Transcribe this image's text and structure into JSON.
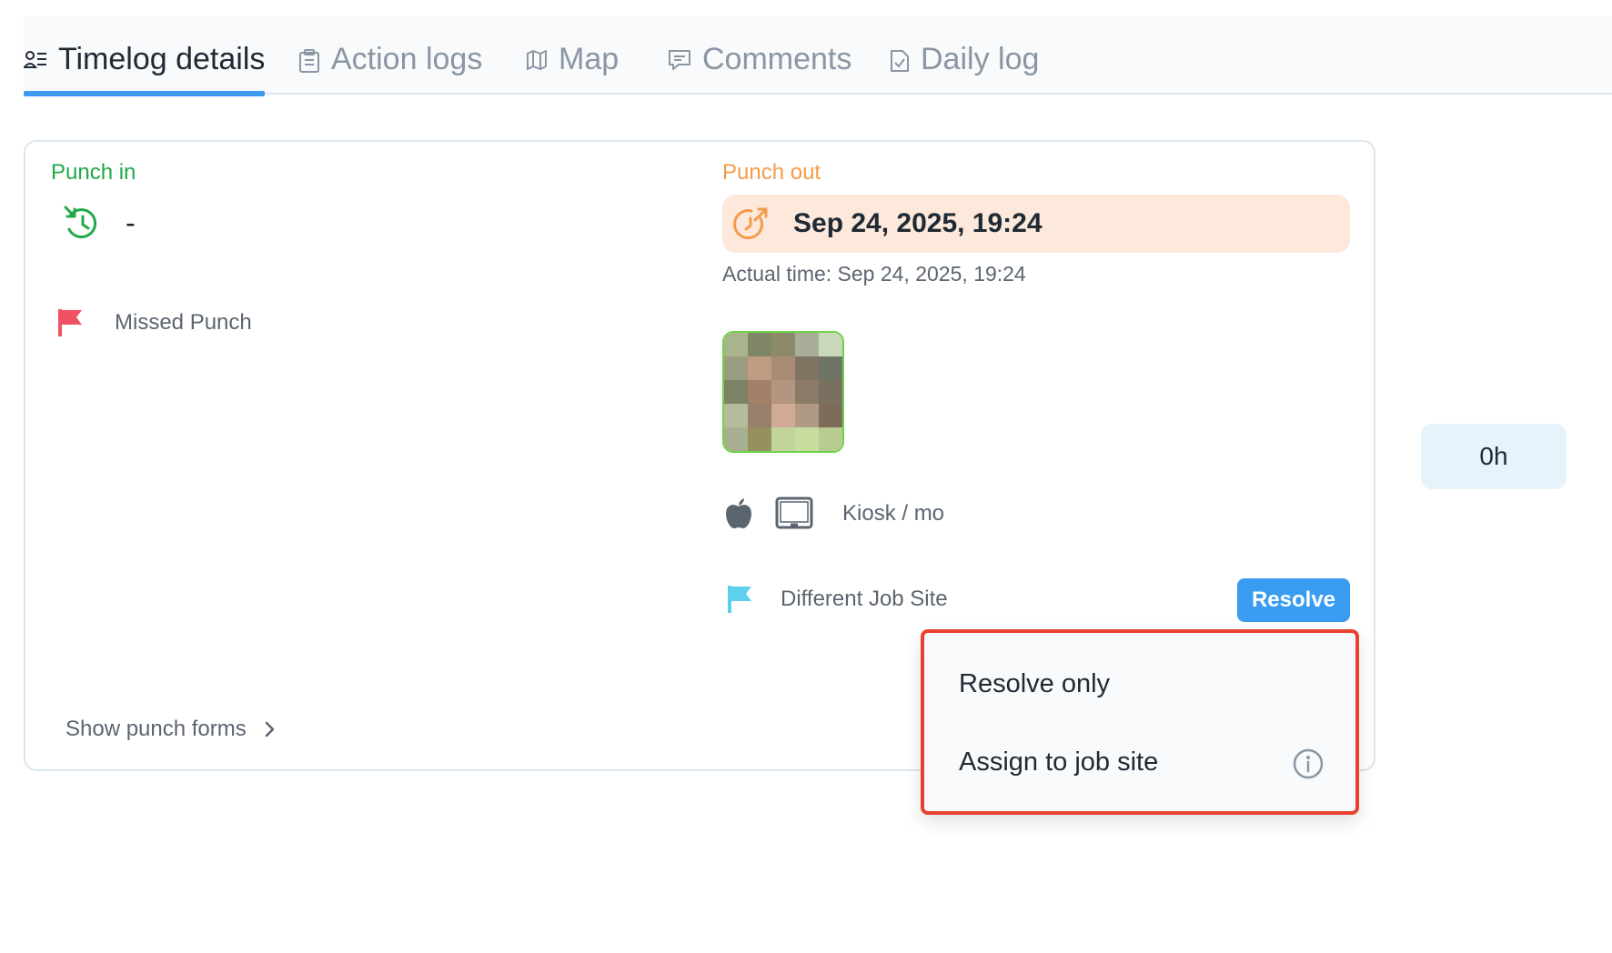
{
  "tabs": [
    {
      "label": "Timelog details",
      "icon": "person-list-icon",
      "active": true
    },
    {
      "label": "Action logs",
      "icon": "clipboard-icon"
    },
    {
      "label": "Map",
      "icon": "map-icon"
    },
    {
      "label": "Comments",
      "icon": "comment-icon"
    },
    {
      "label": "Daily log",
      "icon": "file-check-icon"
    }
  ],
  "punch_in": {
    "label": "Punch in",
    "time": "-",
    "flag_label": "Missed Punch"
  },
  "punch_out": {
    "label": "Punch out",
    "time": "Sep 24, 2025, 19:24",
    "actual_time": "Actual time: Sep 24, 2025, 19:24",
    "device": "Kiosk / mo",
    "flag_label": "Different Job Site",
    "resolve_label": "Resolve"
  },
  "show_punch_forms": "Show punch forms",
  "total_hours": "0h",
  "resolve_menu": {
    "items": [
      "Resolve only",
      "Assign to job site"
    ]
  },
  "colors": {
    "accent": "#3b99ee",
    "punch_in": "#22a94a",
    "punch_out": "#f59b4c",
    "missed_flag": "#ef5363",
    "job_flag": "#5cd0ec",
    "highlight_border": "#e8412f"
  }
}
